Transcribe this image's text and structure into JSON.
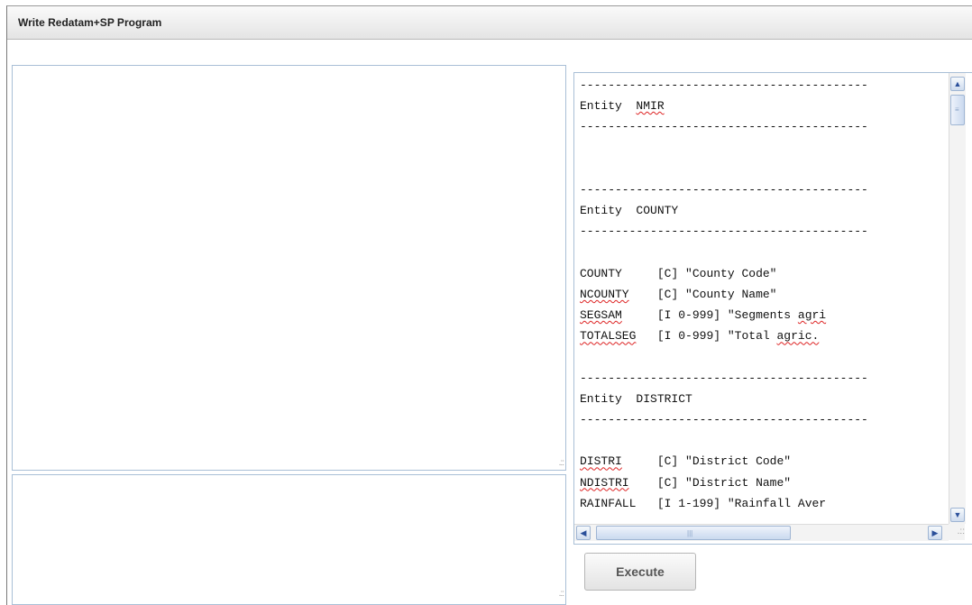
{
  "window": {
    "title": "Write Redatam+SP Program"
  },
  "program_editor": {
    "value": ""
  },
  "output_area": {
    "value": ""
  },
  "dictionary_view": {
    "lines": [
      {
        "text": "-----------------------------------------"
      },
      {
        "text": "Entity  NMIR"
      },
      {
        "text": "-----------------------------------------"
      },
      {
        "text": ""
      },
      {
        "text": ""
      },
      {
        "text": "-----------------------------------------"
      },
      {
        "text": "Entity  COUNTY"
      },
      {
        "text": "-----------------------------------------"
      },
      {
        "text": ""
      },
      {
        "text": "COUNTY     [C] \"County Code\""
      },
      {
        "text": "NCOUNTY    [C] \"County Name\""
      },
      {
        "text": "SEGSAM     [I 0-999] \"Segments agri"
      },
      {
        "text": "TOTALSEG   [I 0-999] \"Total agric."
      },
      {
        "text": ""
      },
      {
        "text": "-----------------------------------------"
      },
      {
        "text": "Entity  DISTRICT"
      },
      {
        "text": "-----------------------------------------"
      },
      {
        "text": ""
      },
      {
        "text": "DISTRI     [C] \"District Code\""
      },
      {
        "text": "NDISTRI    [C] \"District Name\""
      },
      {
        "text": "RAINFALL   [I 1-199] \"Rainfall Aver"
      }
    ]
  },
  "scrollbars": {
    "up_arrow_icon": "triangle-up",
    "down_arrow_icon": "triangle-down",
    "left_arrow_icon": "triangle-left",
    "right_arrow_icon": "triangle-right"
  },
  "buttons": {
    "execute_label": "Execute"
  },
  "colors": {
    "scroll_accent": "#2a4f9a",
    "textarea_border": "#a9bfd6"
  }
}
